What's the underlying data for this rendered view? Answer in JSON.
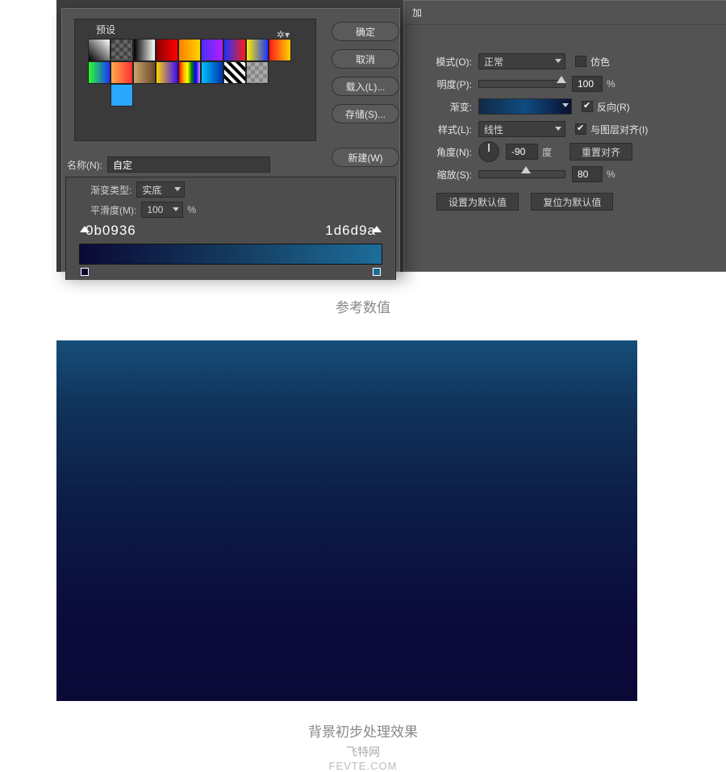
{
  "right_panel": {
    "top_add": "加",
    "mode_label": "模式(O):",
    "mode_value": "正常",
    "dither": "仿色",
    "opacity_label": "明度(P):",
    "opacity_value": "100",
    "pct": "%",
    "gradient_label": "渐变:",
    "reverse": "反向(R)",
    "style_label": "样式(L):",
    "style_value": "线性",
    "align": "与图层对齐(I)",
    "angle_label": "角度(N):",
    "angle_value": "-90",
    "angle_unit": "度",
    "reset_align": "重置对齐",
    "scale_label": "缩放(S):",
    "scale_value": "80",
    "set_default": "设置为默认值",
    "reset_default": "复位为默认值"
  },
  "editor": {
    "presets_title": "预设",
    "gear": "✲▾",
    "buttons": {
      "ok": "确定",
      "cancel": "取消",
      "load": "载入(L)...",
      "save": "存储(S)...",
      "new": "新建(W)"
    },
    "name_label": "名称(N):",
    "name_value": "自定",
    "type_label": "渐变类型:",
    "type_value": "实底",
    "smooth_label": "平滑度(M):",
    "smooth_value": "100",
    "pct": "%",
    "stop_left": "0b0936",
    "stop_right": "1d6d9a"
  },
  "captions": {
    "c1": "参考数值",
    "c2": "背景初步处理效果",
    "c3": "飞特网",
    "c4": "FEVTE.COM"
  }
}
